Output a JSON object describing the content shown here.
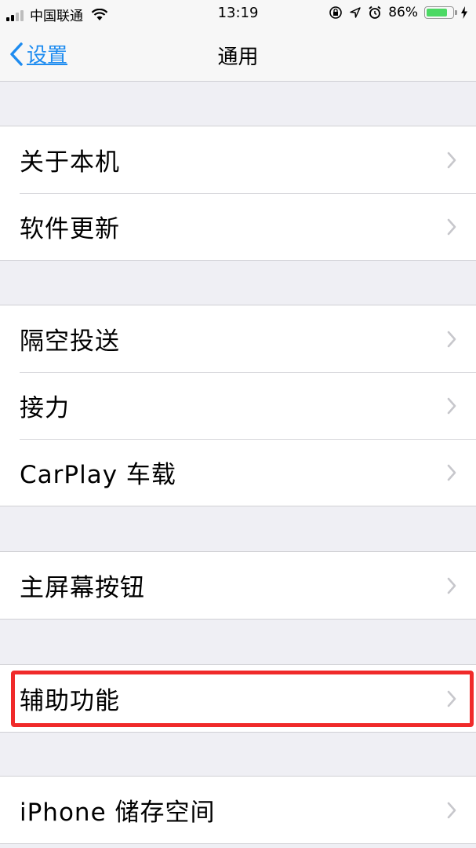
{
  "status_bar": {
    "carrier": "中国联通",
    "time": "13:19",
    "battery": "86%",
    "battery_level": 0.86,
    "icons": [
      "signal-icon",
      "wifi-icon",
      "orientation-lock-icon",
      "location-icon",
      "alarm-icon",
      "battery-icon",
      "charging-icon"
    ]
  },
  "nav": {
    "back_label": "设置",
    "title": "通用",
    "accent": "#1e8cf0"
  },
  "groups": [
    {
      "items": [
        {
          "label": "关于本机"
        },
        {
          "label": "软件更新"
        }
      ]
    },
    {
      "items": [
        {
          "label": "隔空投送"
        },
        {
          "label": "接力"
        },
        {
          "label": "CarPlay 车载"
        }
      ]
    },
    {
      "items": [
        {
          "label": "主屏幕按钮"
        }
      ]
    },
    {
      "items": [
        {
          "label": "辅助功能"
        }
      ]
    },
    {
      "items": [
        {
          "label": "iPhone 储存空间"
        }
      ]
    }
  ],
  "highlight_color": "#f02a2a"
}
